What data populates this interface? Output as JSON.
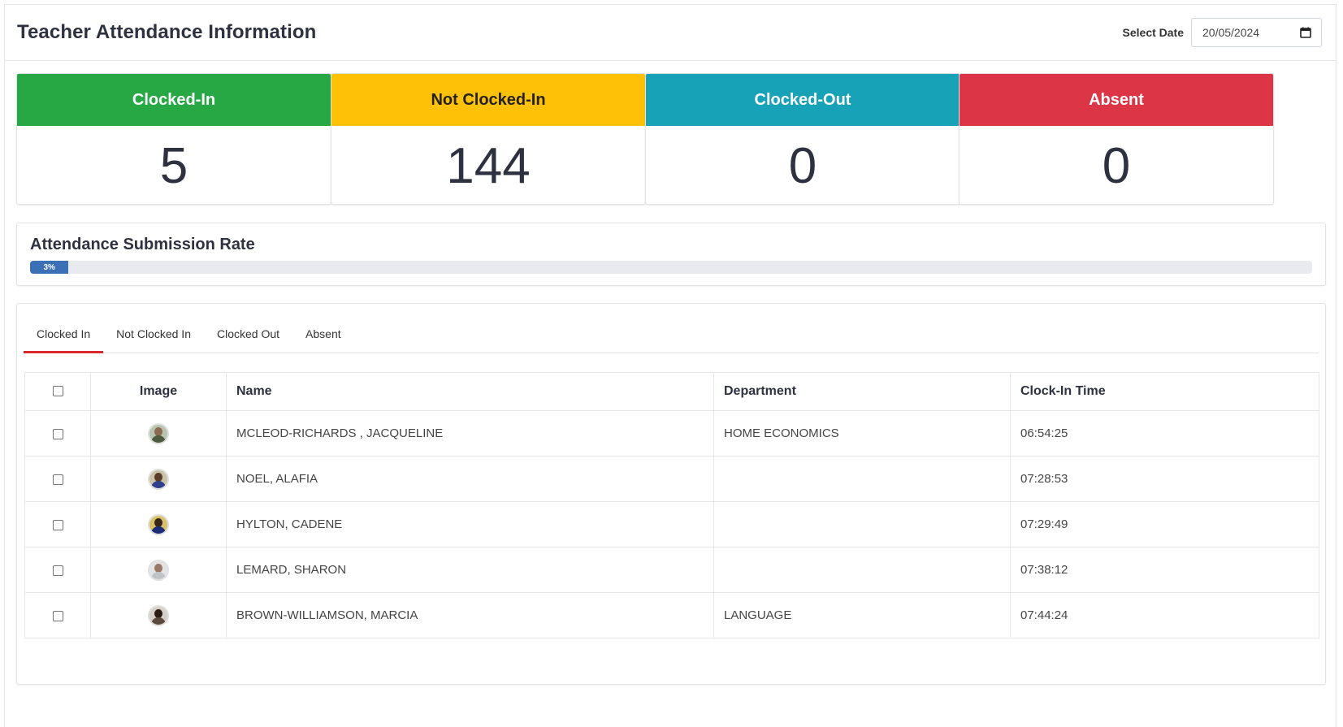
{
  "header": {
    "title": "Teacher Attendance Information",
    "date_label": "Select Date",
    "date_value": "20/05/2024"
  },
  "stats": [
    {
      "label": "Clocked-In",
      "value": "5",
      "color": "#28a745",
      "text_color": "#ffffff"
    },
    {
      "label": "Not Clocked-In",
      "value": "144",
      "color": "#ffc107",
      "text_color": "#222222"
    },
    {
      "label": "Clocked-Out",
      "value": "0",
      "color": "#17a2b8",
      "text_color": "#ffffff"
    },
    {
      "label": "Absent",
      "value": "0",
      "color": "#dc3545",
      "text_color": "#ffffff"
    }
  ],
  "rate": {
    "title": "Attendance Submission Rate",
    "percent_label": "3%",
    "percent": 3
  },
  "tabs": [
    {
      "label": "Clocked In",
      "active": true
    },
    {
      "label": "Not Clocked In",
      "active": false
    },
    {
      "label": "Clocked Out",
      "active": false
    },
    {
      "label": "Absent",
      "active": false
    }
  ],
  "table": {
    "columns": [
      "Image",
      "Name",
      "Department",
      "Clock-In Time"
    ],
    "rows": [
      {
        "name": "MCLEOD-RICHARDS , JACQUELINE",
        "department": "HOME ECONOMICS",
        "time": "06:54:25",
        "avatar": "avatar-photo"
      },
      {
        "name": "NOEL, ALAFIA",
        "department": "",
        "time": "07:28:53",
        "avatar": "avatar-photo"
      },
      {
        "name": "HYLTON, CADENE",
        "department": "",
        "time": "07:29:49",
        "avatar": "avatar-photo"
      },
      {
        "name": "LEMARD, SHARON",
        "department": "",
        "time": "07:38:12",
        "avatar": "avatar-photo"
      },
      {
        "name": "BROWN-WILLIAMSON, MARCIA",
        "department": "LANGUAGE",
        "time": "07:44:24",
        "avatar": "avatar-photo"
      }
    ]
  }
}
